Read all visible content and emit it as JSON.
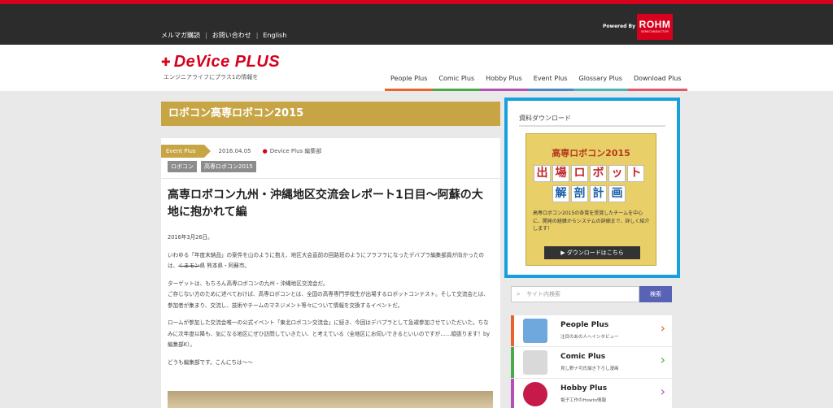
{
  "topbar": {
    "links": [
      "メルマガ購読",
      "お問い合わせ",
      "English"
    ],
    "powered_by": "Powered By",
    "rohm_logo": "ROHM",
    "rohm_sub": "SEMICONDUCTOR"
  },
  "header": {
    "logo_text": "DeVice PLUS",
    "tagline": "エンジニアライフにプラス1の情報を",
    "nav": [
      {
        "label": "People Plus",
        "color": "#e8642d"
      },
      {
        "label": "Comic Plus",
        "color": "#4ba84b"
      },
      {
        "label": "Hobby Plus",
        "color": "#b34fb5"
      },
      {
        "label": "Event Plus",
        "color": "#4f86c6"
      },
      {
        "label": "Glossary Plus",
        "color": "#4fb3b3"
      },
      {
        "label": "Download Plus",
        "color": "#e05a6b"
      }
    ]
  },
  "page_title": "ロボコン高専ロボコン2015",
  "article": {
    "category": "Event Plus",
    "date": "2016.04.05",
    "author": "Device Plus 編集部",
    "tags": [
      "ロボコン",
      "高専ロボコン2015"
    ],
    "title": "高専ロボコン九州・沖縄地区交流会レポート1日目〜阿蘇の大地に抱かれて編",
    "p1": "2016年3月26日。",
    "p2a": "いわゆる「年度末納品」の案件を山のように抱え、地区大会直前の回路班のようにフラフラになったデバプラ編集部員が向かったのは、",
    "p2_strike": "くまモン",
    "p2b": "県 熊本県・阿蘇市。",
    "p3": "ターゲットは、もちろん高専ロボコンの九州・沖縄地区交流会だ。",
    "p4": "ご存じない方のために述べておけば、高専ロボコンとは、全国の高専専門学校生が出場するロボットコンテスト。そして交流会とは、参加者が集まり、交流し、技術やチームのマネジメント等々について情報を交換するイベントだ。",
    "p5": "ロームが参加した交流会唯一の公式イベント「東北ロボコン交流会」に続き、今回はデバプラとして急遽参加させていただいた。ちなみに次年度以降も、気になる地区にぜひ訪問していきたい、と考えている（全地区にお伺いできるといいのですが……頑張ります！by編集部K）。",
    "p6": "どうも編集部です。こんにちは〜〜"
  },
  "download_box": {
    "title": "資料ダウンロード",
    "banner_line1": "高専ロボコン2015",
    "banner_row1": [
      "出",
      "場",
      "ロ",
      "ボ",
      "ッ",
      "ト"
    ],
    "banner_row2": [
      "解",
      "剖",
      "計",
      "画"
    ],
    "banner_desc": "高専ロボコン2015の各賞を受賞したチームを中心に、開発の経緯からシステムの詳細まで、詳しく紹介します！",
    "button": "▶ ダウンロードはこちら"
  },
  "search": {
    "placeholder": "サイト内検索",
    "button": "検索"
  },
  "categories": [
    {
      "title": "People Plus",
      "sub": "注目のあの人へインタビュー",
      "color": "#e8642d"
    },
    {
      "title": "Comic Plus",
      "sub": "見し野ナ可氏描き下ろし漫画",
      "color": "#4ba84b"
    },
    {
      "title": "Hobby Plus",
      "sub": "電子工作のHowto情報",
      "color": "#b34fb5"
    }
  ]
}
